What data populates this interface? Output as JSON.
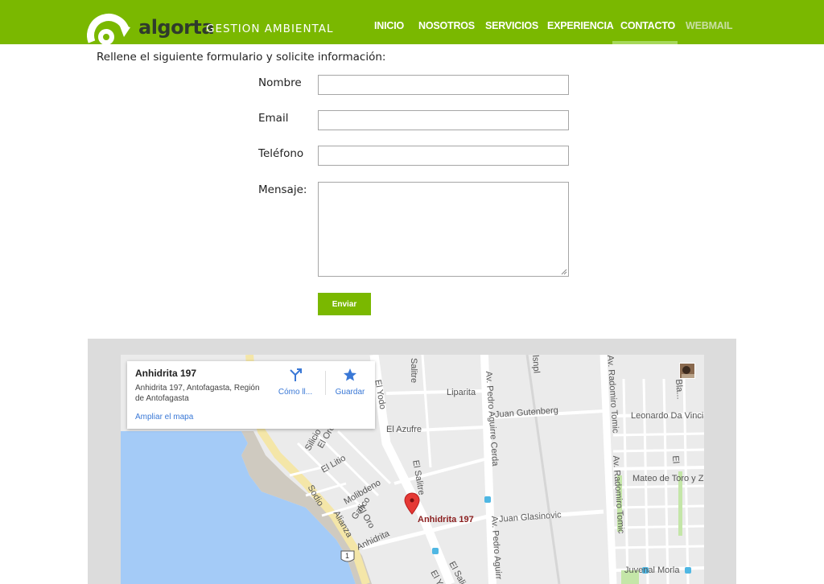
{
  "brand": {
    "name": "algorta",
    "tagline": "GESTION AMBIENTAL",
    "color": "#7ab800"
  },
  "nav": {
    "items": [
      {
        "label": "INICIO",
        "active": false
      },
      {
        "label": "NOSOTROS",
        "active": false
      },
      {
        "label": "SERVICIOS",
        "active": false
      },
      {
        "label": "EXPERIENCIA",
        "active": false
      },
      {
        "label": "CONTACTO",
        "active": true
      },
      {
        "label": "WEBMAIL",
        "active": false
      }
    ]
  },
  "form": {
    "intro": "Rellene el siguiente formulario y solicite información:",
    "fields": [
      {
        "label": "Nombre",
        "value": ""
      },
      {
        "label": "Email",
        "value": ""
      },
      {
        "label": "Teléfono",
        "value": ""
      }
    ],
    "message_label": "Mensaje:",
    "message_value": "",
    "submit_label": "Enviar"
  },
  "map": {
    "card": {
      "title": "Anhidrita 197",
      "address": "Anhidrita 197, Antofagasta, Región de Antofagasta",
      "directions_label": "Cómo ll...",
      "save_label": "Guardar",
      "enlarge_label": "Ampliar el mapa"
    },
    "marker_label": "Anhidrita 197",
    "streets": {
      "salitre1": "Salitre",
      "liparita": "Liparita",
      "juan_gutenberg": "Juan Gutenberg",
      "leonardo": "Leonardo Da Vinci",
      "el_azufre": "El Azufre",
      "el_salitre": "El Salitre",
      "el_litio": "El Litio",
      "silicio": "Silicio",
      "sodio": "Sodio",
      "molibdeno": "Molibdeno",
      "galico": "Galico",
      "el_oro_a": "El Oro",
      "el_oro_b": "El Oro",
      "alianza": "Alianza",
      "anhidrita": "Anhidrita",
      "el_yodo": "El Yodo",
      "el_yodo_b": "El Y",
      "el_sal_b": "El Sali",
      "mateo": "Mateo de Toro y Za",
      "juan_glasinovic": "Juan Glasinovic",
      "juvenal": "Juvenal Morla",
      "pedro_cerda": "Av. Pedro Aguirre Cerda",
      "pedro_aguirre_b": "Av. Pedro Aguirr",
      "radomiro1": "Av. Radomiro Tomic",
      "radomiro2": "Av. Radomiro Tomic",
      "barrio": "Bla...",
      "el_b": "El",
      "route": "1",
      "pedro_mid": "lsnpl"
    }
  }
}
